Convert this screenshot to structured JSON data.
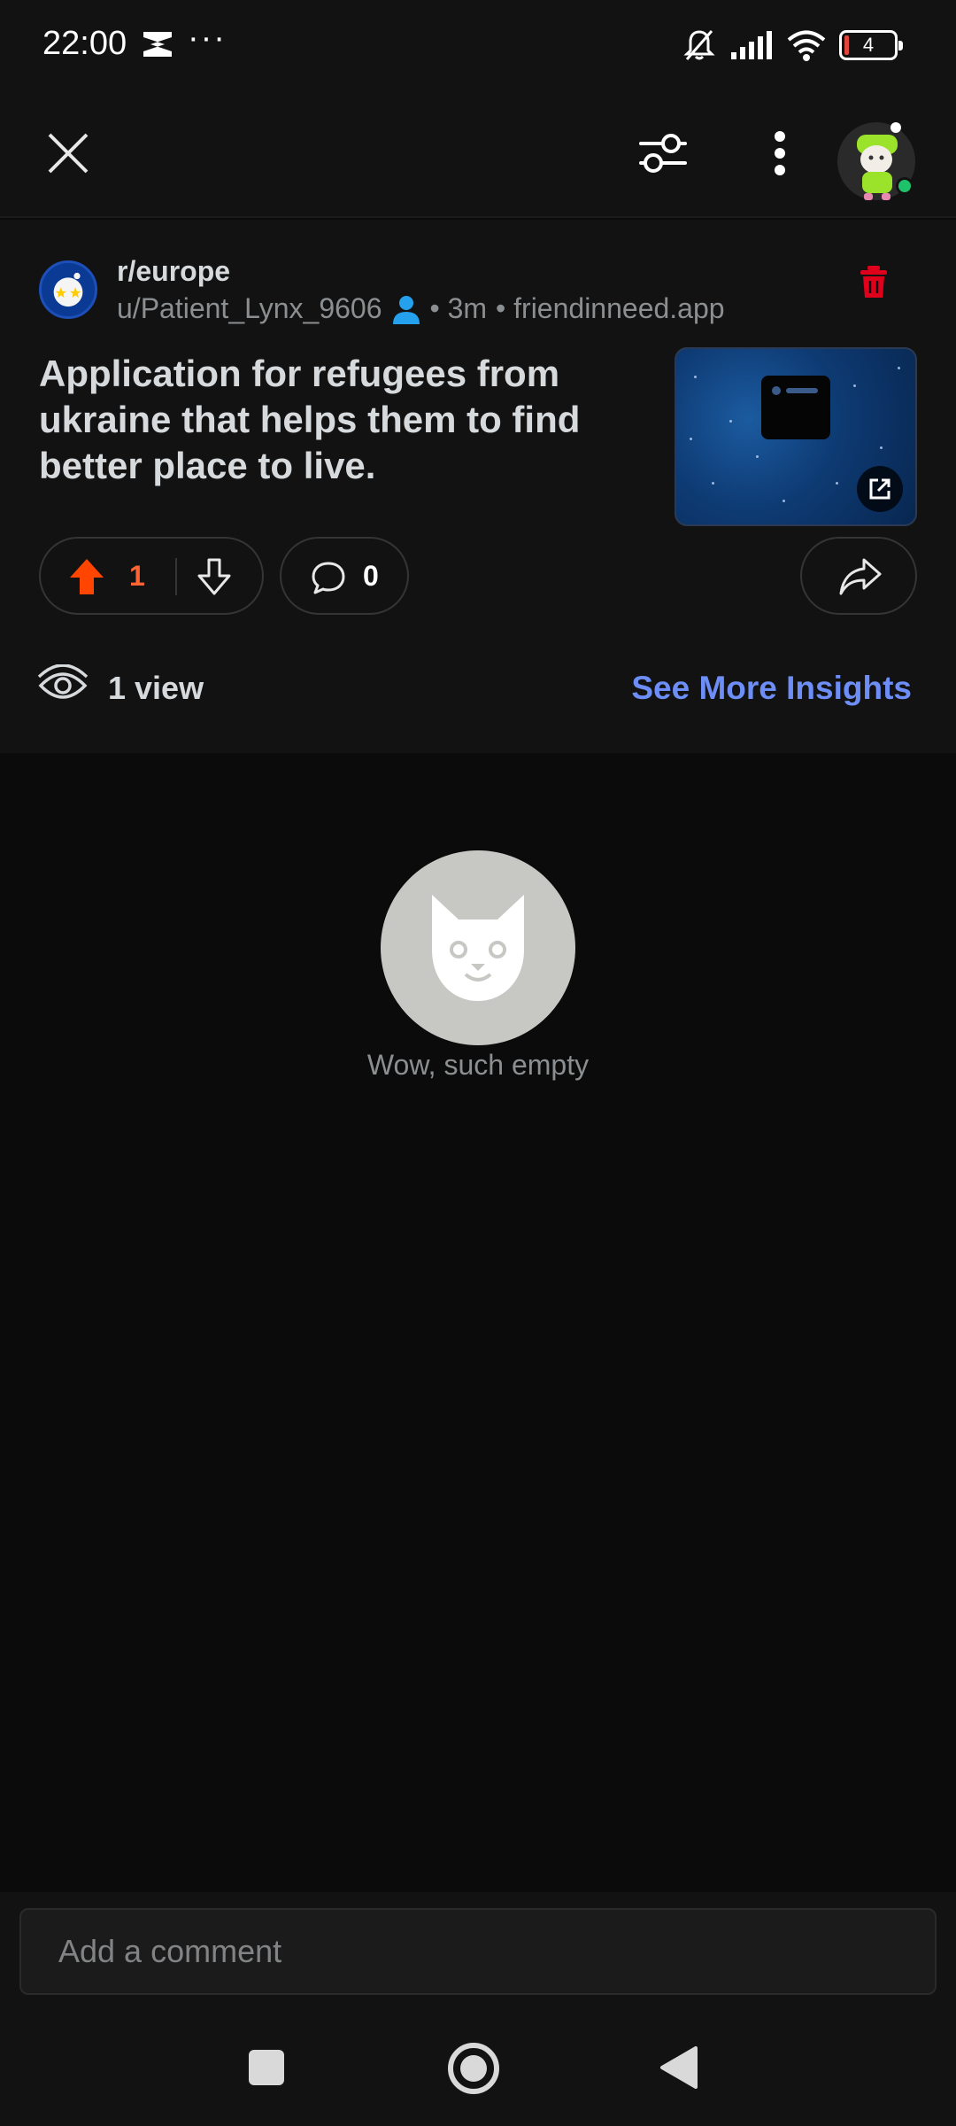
{
  "status_bar": {
    "time": "22:00",
    "dots": "···",
    "battery": "4"
  },
  "toolbar": {
    "close_icon": "close-icon",
    "filter_icon": "sliders-icon",
    "more_icon": "kebab-menu-icon"
  },
  "post": {
    "subreddit": "r/europe",
    "author": "u/Patient_Lynx_9606",
    "age": "• 3m",
    "domain": "• friendinneed.app",
    "title": "Application for refugees from ukraine that helps them to find better place to live.",
    "upvotes": "1",
    "comments": "0",
    "views": "1 view",
    "insights_label": "See More Insights"
  },
  "empty_state": {
    "text": "Wow, such empty"
  },
  "comment_bar": {
    "placeholder": "Add a comment"
  },
  "colors": {
    "accent_upvote": "#ff4500",
    "link_blue": "#6e8ef7",
    "delete_red": "#e0001b",
    "user_blue": "#24a0ed"
  }
}
